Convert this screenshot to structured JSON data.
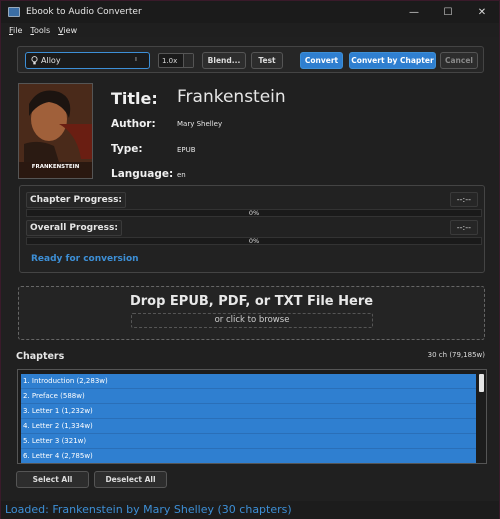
{
  "window": {
    "title": "Ebook to Audio Converter",
    "controls": {
      "minimize": "—",
      "maximize": "☐",
      "close": "✕"
    }
  },
  "menu": [
    {
      "label": "File",
      "accel": "F"
    },
    {
      "label": "Tools",
      "accel": "T"
    },
    {
      "label": "View",
      "accel": "V"
    }
  ],
  "toolbar": {
    "voice": "Alloy",
    "voice_icon": "lightbulb-icon",
    "speed": "1.0x",
    "blend_label": "Blend...",
    "test_label": "Test",
    "convert_label": "Convert",
    "convert_by_chapter_label": "Convert by Chapter",
    "cancel_label": "Cancel"
  },
  "book": {
    "cover_title": "FRANKENSTEIN",
    "title_label": "Title:",
    "title": "Frankenstein",
    "author_label": "Author:",
    "author": "Mary Shelley",
    "type_label": "Type:",
    "type": "EPUB",
    "language_label": "Language:",
    "language": "en"
  },
  "progress": {
    "chapter_label": "Chapter Progress:",
    "chapter_time": "--:--",
    "chapter_pct_text": "0%",
    "chapter_fraction": 0,
    "overall_label": "Overall Progress:",
    "overall_time": "--:--",
    "overall_pct_text": "0%",
    "overall_fraction": 0,
    "status": "Ready for conversion"
  },
  "dropzone": {
    "title": "Drop EPUB, PDF, or TXT File Here",
    "subtitle": "or click to browse"
  },
  "chapters": {
    "title": "Chapters",
    "count": "30 ch (79,185w)",
    "items": [
      "1. Introduction (2,283w)",
      "2. Preface (588w)",
      "3. Letter 1 (1,232w)",
      "4. Letter 2 (1,334w)",
      "5. Letter 3 (321w)",
      "6. Letter 4 (2,785w)"
    ],
    "select_all_label": "Select All",
    "deselect_all_label": "Deselect All"
  },
  "statusbar": {
    "text": "Loaded: Frankenstein by Mary Shelley (30 chapters)"
  },
  "colors": {
    "accent": "#2f7fd0",
    "status_text": "#3d8fd6",
    "background": "#202020"
  }
}
